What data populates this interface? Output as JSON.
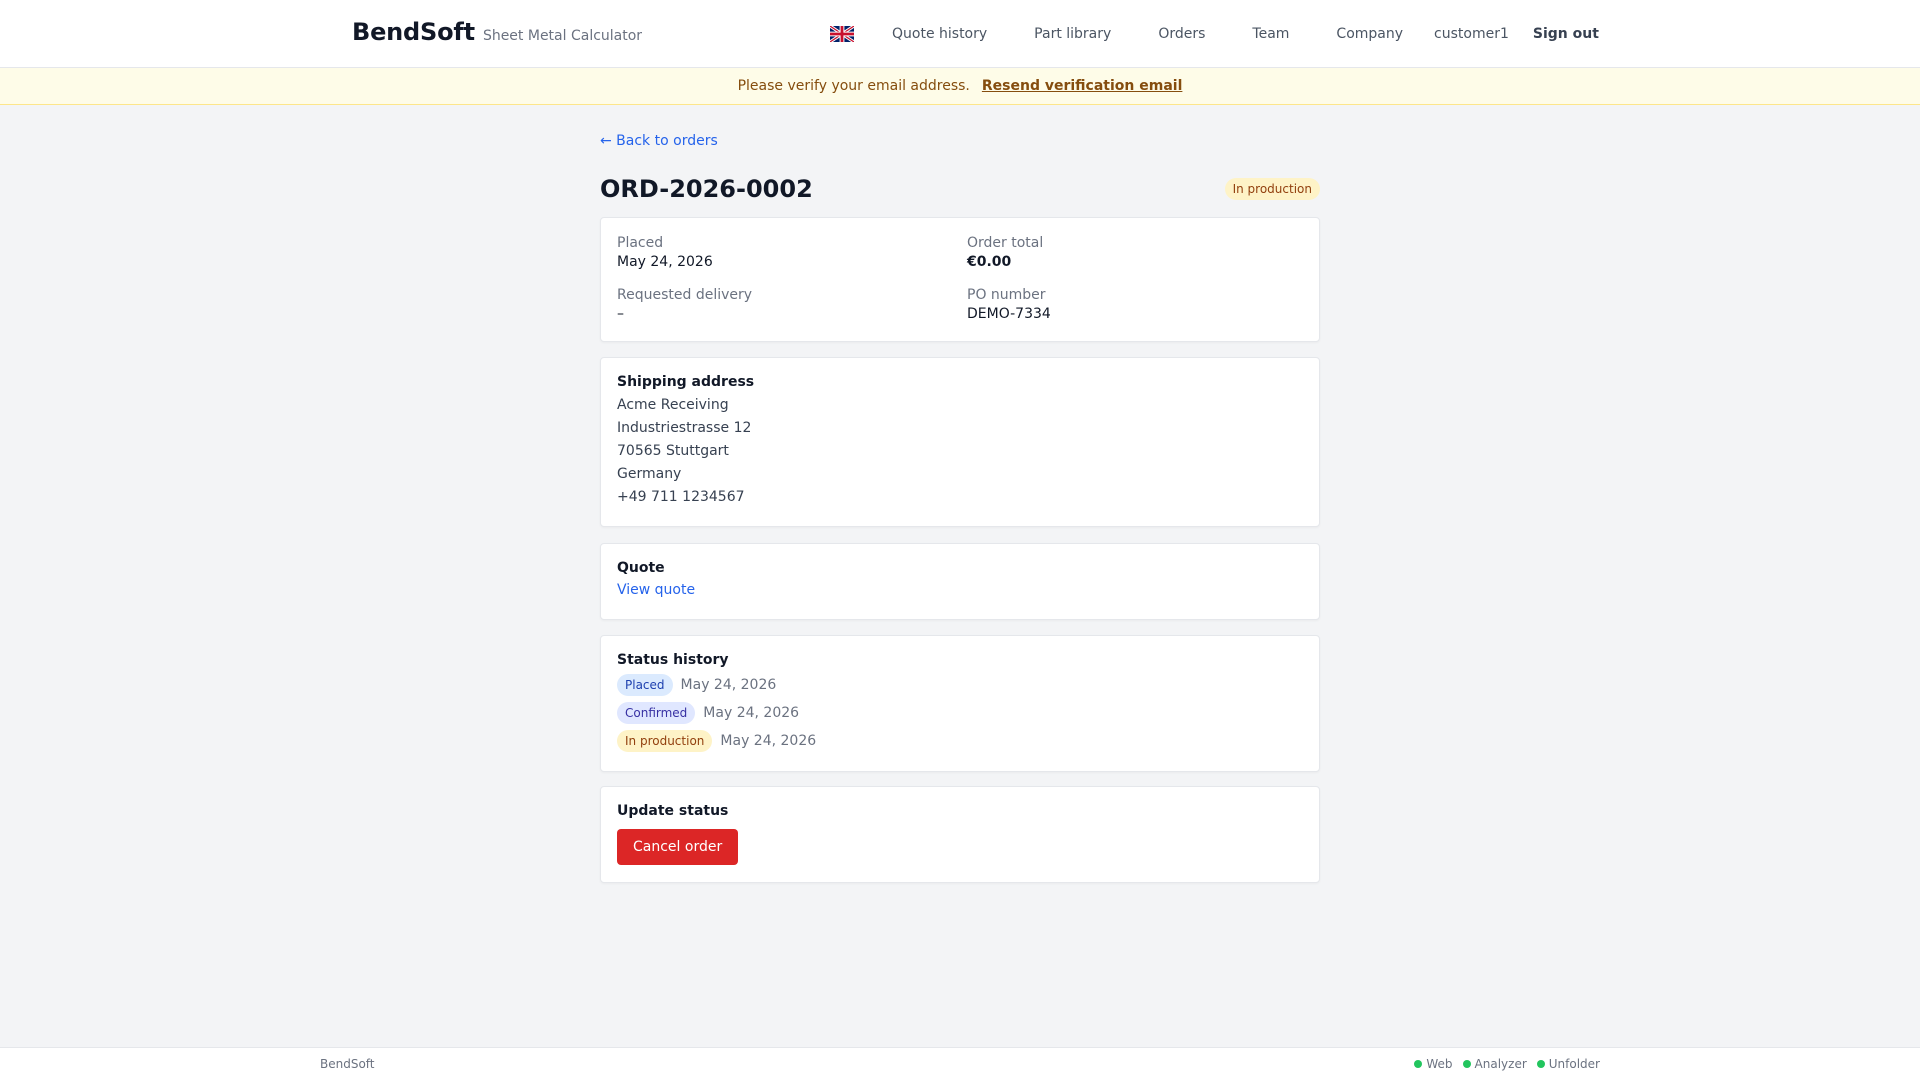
{
  "header": {
    "brand_name": "BendSoft",
    "brand_sub": "Sheet Metal Calculator",
    "flag_icon": "uk-flag-icon",
    "nav": {
      "quote_history": "Quote history",
      "part_library": "Part library",
      "orders": "Orders",
      "team": "Team",
      "company": "Company"
    },
    "user": "customer1",
    "sign_out": "Sign out"
  },
  "banner": {
    "text": "Please verify your email address.",
    "link": "Resend verification email"
  },
  "main": {
    "back_link": "← Back to orders",
    "order_id": "ORD-2026-0002",
    "status_badge": "In production",
    "summary": {
      "placed_label": "Placed",
      "placed_value": "May 24, 2026",
      "total_label": "Order total",
      "total_value": "€0.00",
      "delivery_label": "Requested delivery",
      "delivery_value": "–",
      "po_label": "PO number",
      "po_value": "DEMO-7334"
    },
    "shipping": {
      "title": "Shipping address",
      "lines": [
        "Acme Receiving",
        "Industriestrasse 12",
        "70565 Stuttgart",
        "Germany",
        "+49 711 1234567"
      ]
    },
    "quote": {
      "title": "Quote",
      "link": "View quote"
    },
    "history": {
      "title": "Status history",
      "entries": [
        {
          "status": "Placed",
          "date": "May 24, 2026"
        },
        {
          "status": "Confirmed",
          "date": "May 24, 2026"
        },
        {
          "status": "In production",
          "date": "May 24, 2026"
        }
      ]
    },
    "update": {
      "title": "Update status",
      "cancel_button": "Cancel order"
    }
  },
  "footer": {
    "brand": "BendSoft",
    "services": [
      {
        "name": "Web",
        "color": "#22c55e"
      },
      {
        "name": "Analyzer",
        "color": "#22c55e"
      },
      {
        "name": "Unfolder",
        "color": "#22c55e"
      }
    ]
  },
  "colors": {
    "accent_link": "#2563eb",
    "danger": "#dc2626",
    "banner_bg": "#fefce8",
    "status_ok": "#22c55e"
  }
}
